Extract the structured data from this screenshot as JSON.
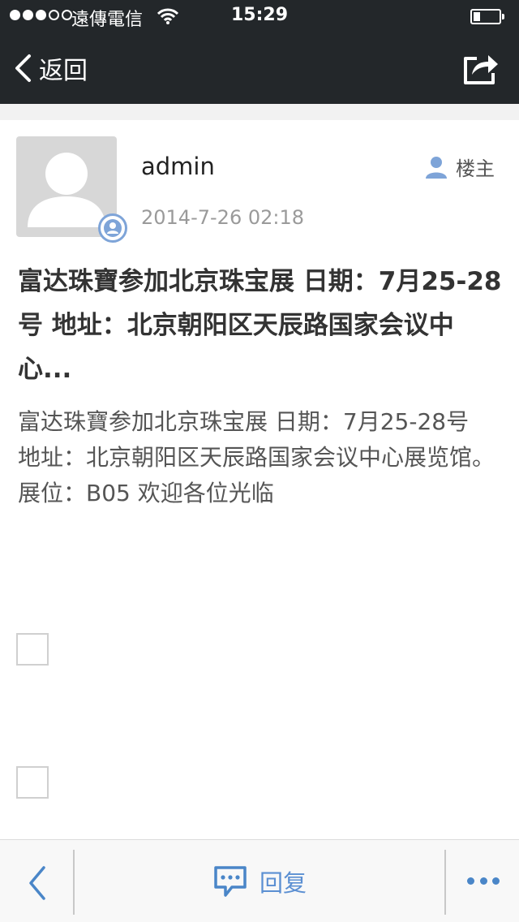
{
  "status_bar": {
    "carrier": "遠傳電信",
    "time": "15:29",
    "battery_level": 0.25
  },
  "nav": {
    "back_label": "返回"
  },
  "post": {
    "author": "admin",
    "date": "2014-7-26 02:18",
    "author_tag": "楼主",
    "title": "富达珠寶参加北京珠宝展 日期：7月25-28号 地址：北京朝阳区天辰路国家会议中心...",
    "body_lines": [
      "富达珠寶参加北京珠宝展 日期：7月25-28号",
      "地址：北京朝阳区天辰路国家会议中心展览馆。",
      "展位：B05 欢迎各位光临"
    ]
  },
  "toolbar": {
    "reply_label": "回复"
  },
  "icons": {
    "back": "chevron-left-icon",
    "share": "share-icon",
    "author": "person-icon",
    "reply": "chat-bubble-icon",
    "more": "more-dots-icon"
  },
  "colors": {
    "header_bg": "#23272a",
    "accent": "#5b8fd2",
    "date_text": "#9a9a9a"
  }
}
